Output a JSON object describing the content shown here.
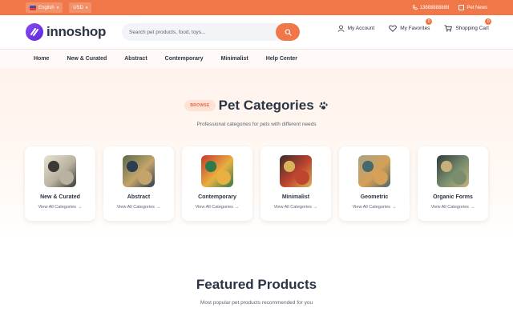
{
  "topbar": {
    "language": "English",
    "currency": "USD",
    "phone": "13888888888",
    "news": "Pet News"
  },
  "header": {
    "brand": "innoshop",
    "search_placeholder": "Search pet products, food, toys...",
    "account_label": "My Account",
    "favorites_label": "My Favorites",
    "favorites_count": "0",
    "cart_label": "Shopping Cart",
    "cart_count": "0"
  },
  "nav": {
    "items": [
      {
        "label": "Home"
      },
      {
        "label": "New & Curated"
      },
      {
        "label": "Abstract"
      },
      {
        "label": "Contemporary"
      },
      {
        "label": "Minimalist"
      },
      {
        "label": "Help Center"
      }
    ]
  },
  "categories": {
    "badge": "BROWSE",
    "title": "Pet Categories",
    "subtitle": "Professional categories for pets with different needs",
    "link_label": "View All Categories",
    "items": [
      {
        "name": "New & Curated",
        "palette": [
          "#e8e2d2",
          "#b9b2a0",
          "#3c3a36"
        ]
      },
      {
        "name": "Abstract",
        "palette": [
          "#5b6a4a",
          "#c4a46a",
          "#2c3e50"
        ]
      },
      {
        "name": "Contemporary",
        "palette": [
          "#c8382c",
          "#e8b040",
          "#2f7a4a"
        ]
      },
      {
        "name": "Minimalist",
        "palette": [
          "#3b2a2a",
          "#c0452f",
          "#d9b45a"
        ]
      },
      {
        "name": "Geometric",
        "palette": [
          "#a9a382",
          "#d6a058",
          "#46696d"
        ]
      },
      {
        "name": "Organic Forms",
        "palette": [
          "#2e3b3c",
          "#7a8e6e",
          "#c8b07a"
        ]
      }
    ]
  },
  "featured": {
    "title": "Featured Products",
    "subtitle": "Most popular pet products recommended for you"
  },
  "colors": {
    "accent": "#f07848",
    "brand": "#6a35e0",
    "text": "#2b3445"
  }
}
